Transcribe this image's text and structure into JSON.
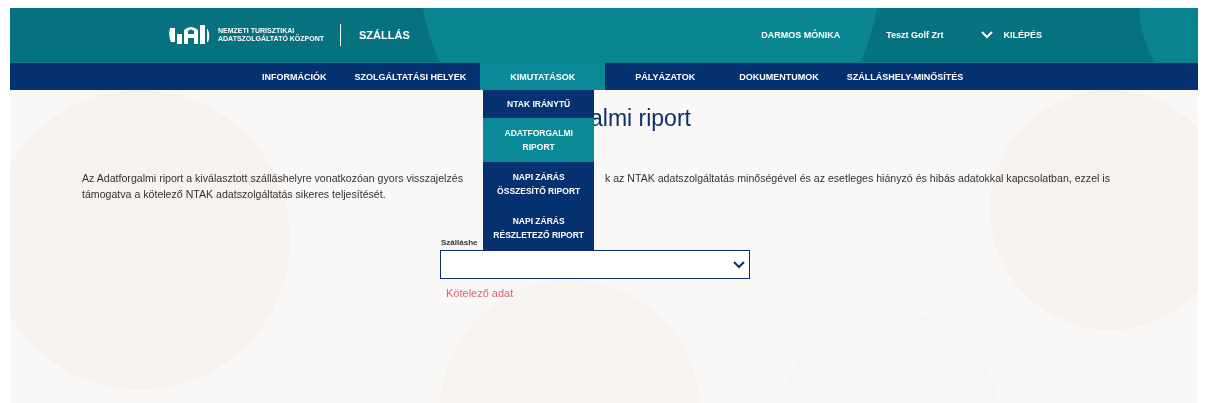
{
  "header": {
    "org_name_lines": [
      "NEMZETI TURISZTIKAI",
      "ADATSZOLGÁLTATÓ KÖZPONT"
    ],
    "app_name": "SZÁLLÁS",
    "user": "DARMOS MÓNIKA",
    "company": "Teszt Golf Zrt",
    "logout": "KILÉPÉS"
  },
  "nav": [
    {
      "label": "INFORMÁCIÓK",
      "selected": false
    },
    {
      "label": "SZOLGÁLTATÁSI HELYEK",
      "selected": false
    },
    {
      "label": "KIMUTATÁSOK",
      "selected": true
    },
    {
      "label": "PÁLYÁZATOK",
      "selected": false
    },
    {
      "label": "DOKUMENTUMOK",
      "selected": false
    },
    {
      "label": "SZÁLLÁSHELY-MINŐSÍTÉS",
      "selected": false
    }
  ],
  "dropdown": [
    {
      "lines": [
        "NTAK IRÁNYTŰ"
      ],
      "selected": false
    },
    {
      "lines": [
        "ADATFORGALMI",
        "RIPORT"
      ],
      "selected": true
    },
    {
      "lines": [
        "NAPI ZÁRÁS",
        "ÖSSZESÍTŐ RIPORT"
      ],
      "selected": false
    },
    {
      "lines": [
        "NAPI ZÁRÁS",
        "RÉSZLETEZŐ RIPORT"
      ],
      "selected": false
    }
  ],
  "page_title": "almi riport",
  "intro": {
    "line_1_left": "Az Adatforgalmi riport a kiválasztott szálláshelyre vonatkozóan gyors visszajelzés",
    "line_1_right": "k az NTAK adatszolgáltatás minőségével és az esetleges hiányzó és hibás adatokkal kapcsolatban, ezzel is",
    "line_2": "támogatva a kötelező NTAK adatszolgáltatás sikeres teljesítését."
  },
  "form": {
    "label": "Szálláshe",
    "error": "Kötelező adat"
  }
}
